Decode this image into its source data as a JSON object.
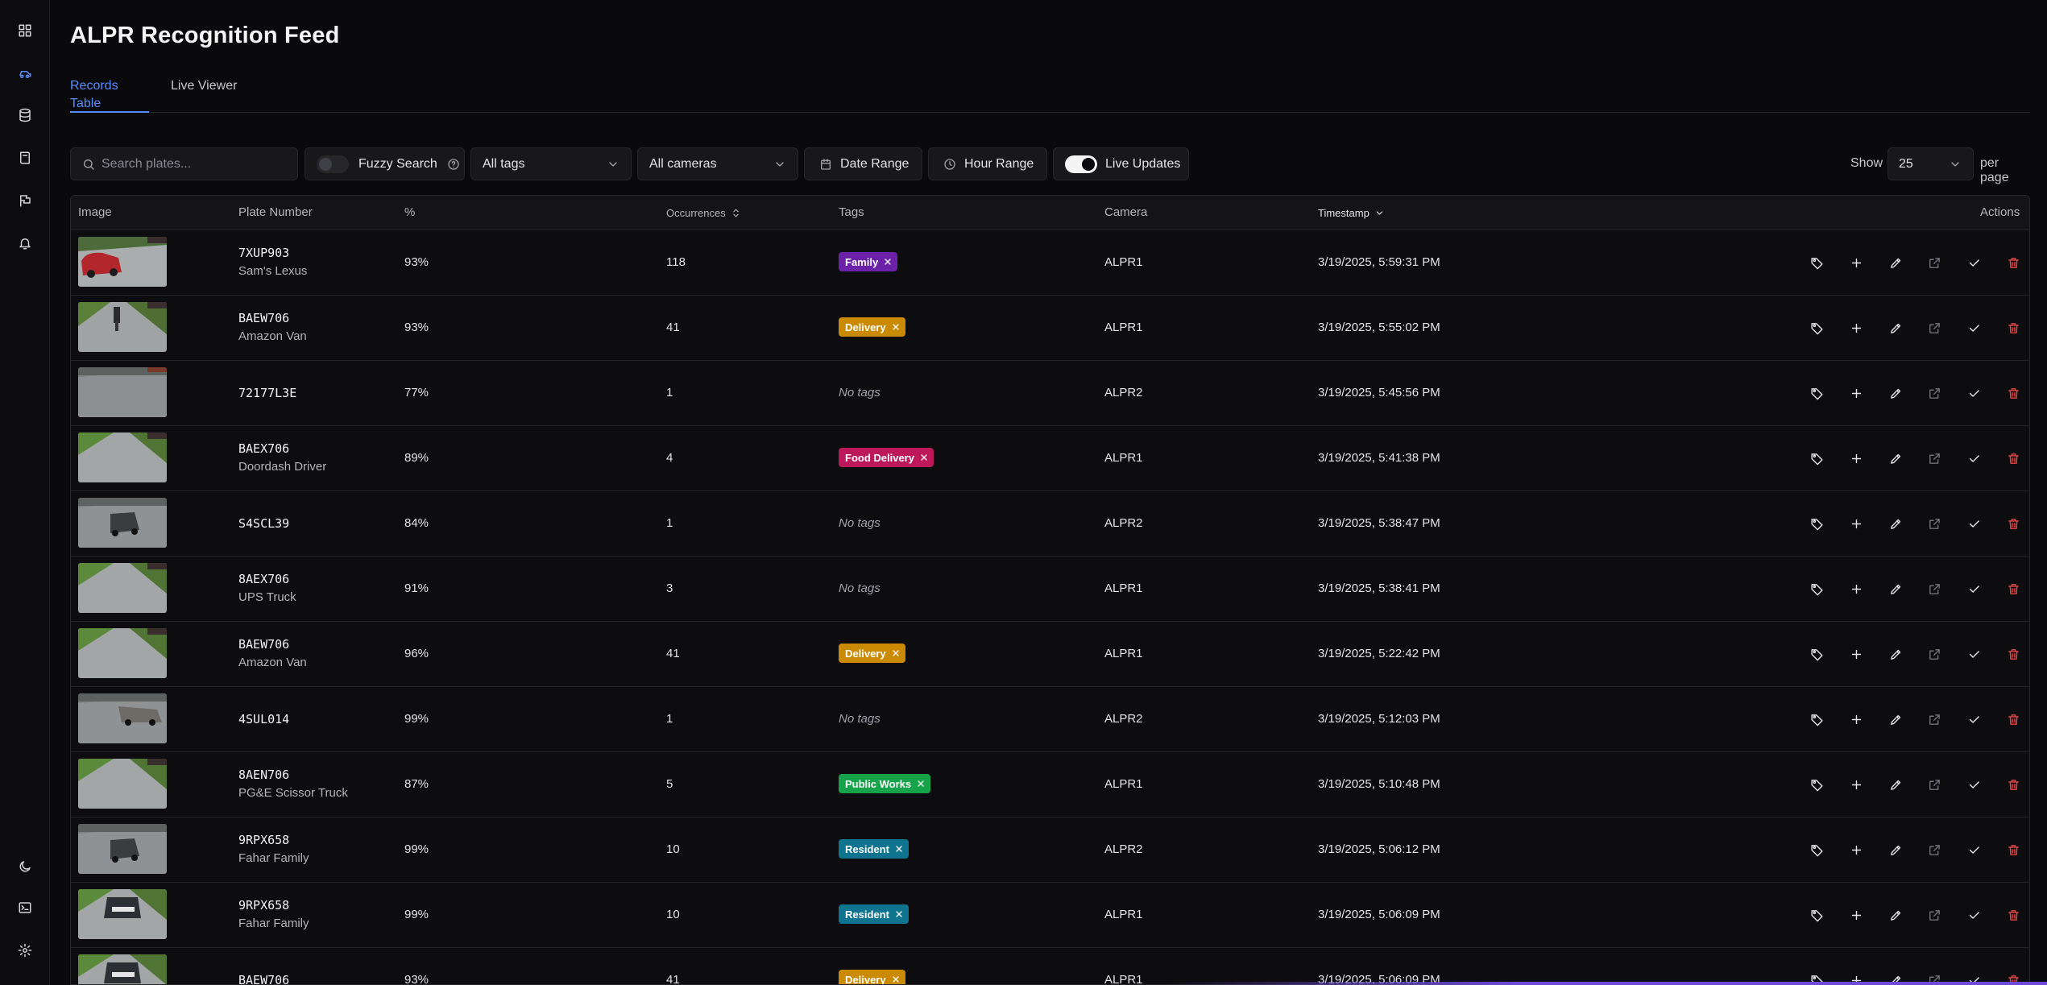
{
  "page": {
    "title": "ALPR Recognition Feed"
  },
  "tabs": [
    {
      "label": "Records Table",
      "active": true
    },
    {
      "label": "Live Viewer",
      "active": false
    }
  ],
  "toolbar": {
    "search_placeholder": "Search plates...",
    "fuzzy_label": "Fuzzy Search",
    "fuzzy_on": false,
    "tags_select": "All tags",
    "cameras_select": "All cameras",
    "date_range_label": "Date Range",
    "hour_range_label": "Hour Range",
    "live_updates_label": "Live Updates",
    "live_updates_on": true,
    "show_label": "Show",
    "per_page_value": "25",
    "per_page_label": "per page"
  },
  "table": {
    "headers": {
      "image": "Image",
      "plate": "Plate Number",
      "percent": "%",
      "occurrences": "Occurrences",
      "tags": "Tags",
      "camera": "Camera",
      "timestamp": "Timestamp",
      "actions": "Actions"
    },
    "no_tags_label": "No tags",
    "rows": [
      {
        "plate": "7XUP903",
        "desc": "Sam's Lexus",
        "pct": "93%",
        "occ": "118",
        "tag": "Family",
        "tag_color": "#6b21a8",
        "camera": "ALPR1",
        "time": "3/19/2025, 5:59:31 PM",
        "thumb": "red-car"
      },
      {
        "plate": "BAEW706",
        "desc": "Amazon Van",
        "pct": "93%",
        "occ": "41",
        "tag": "Delivery",
        "tag_color": "#ca8a04",
        "camera": "ALPR1",
        "time": "3/19/2025, 5:55:02 PM",
        "thumb": "driveway-person"
      },
      {
        "plate": "72177L3E",
        "desc": "",
        "pct": "77%",
        "occ": "1",
        "tag": "",
        "tag_color": "",
        "camera": "ALPR2",
        "time": "3/19/2025, 5:45:56 PM",
        "thumb": "road"
      },
      {
        "plate": "BAEX706",
        "desc": "Doordash Driver",
        "pct": "89%",
        "occ": "4",
        "tag": "Food Delivery",
        "tag_color": "#be185d",
        "camera": "ALPR1",
        "time": "3/19/2025, 5:41:38 PM",
        "thumb": "driveway"
      },
      {
        "plate": "S4SCL39",
        "desc": "",
        "pct": "84%",
        "occ": "1",
        "tag": "",
        "tag_color": "",
        "camera": "ALPR2",
        "time": "3/19/2025, 5:38:47 PM",
        "thumb": "road-suv"
      },
      {
        "plate": "8AEX706",
        "desc": "UPS Truck",
        "pct": "91%",
        "occ": "3",
        "tag": "",
        "tag_color": "",
        "camera": "ALPR1",
        "time": "3/19/2025, 5:38:41 PM",
        "thumb": "driveway"
      },
      {
        "plate": "BAEW706",
        "desc": "Amazon Van",
        "pct": "96%",
        "occ": "41",
        "tag": "Delivery",
        "tag_color": "#ca8a04",
        "camera": "ALPR1",
        "time": "3/19/2025, 5:22:42 PM",
        "thumb": "driveway"
      },
      {
        "plate": "4SUL014",
        "desc": "",
        "pct": "99%",
        "occ": "1",
        "tag": "",
        "tag_color": "",
        "camera": "ALPR2",
        "time": "3/19/2025, 5:12:03 PM",
        "thumb": "road-sedan"
      },
      {
        "plate": "8AEN706",
        "desc": "PG&E Scissor Truck",
        "pct": "87%",
        "occ": "5",
        "tag": "Public Works",
        "tag_color": "#16a34a",
        "camera": "ALPR1",
        "time": "3/19/2025, 5:10:48 PM",
        "thumb": "driveway"
      },
      {
        "plate": "9RPX658",
        "desc": "Fahar Family",
        "pct": "99%",
        "occ": "10",
        "tag": "Resident",
        "tag_color": "#0e7490",
        "camera": "ALPR2",
        "time": "3/19/2025, 5:06:12 PM",
        "thumb": "road-suv"
      },
      {
        "plate": "9RPX658",
        "desc": "Fahar Family",
        "pct": "99%",
        "occ": "10",
        "tag": "Resident",
        "tag_color": "#0e7490",
        "camera": "ALPR1",
        "time": "3/19/2025, 5:06:09 PM",
        "thumb": "driveway-suv"
      },
      {
        "plate": "BAEW706",
        "desc": "",
        "pct": "93%",
        "occ": "41",
        "tag": "Delivery",
        "tag_color": "#ca8a04",
        "camera": "ALPR1",
        "time": "3/19/2025, 5:06:09 PM",
        "thumb": "driveway-suv"
      }
    ]
  }
}
